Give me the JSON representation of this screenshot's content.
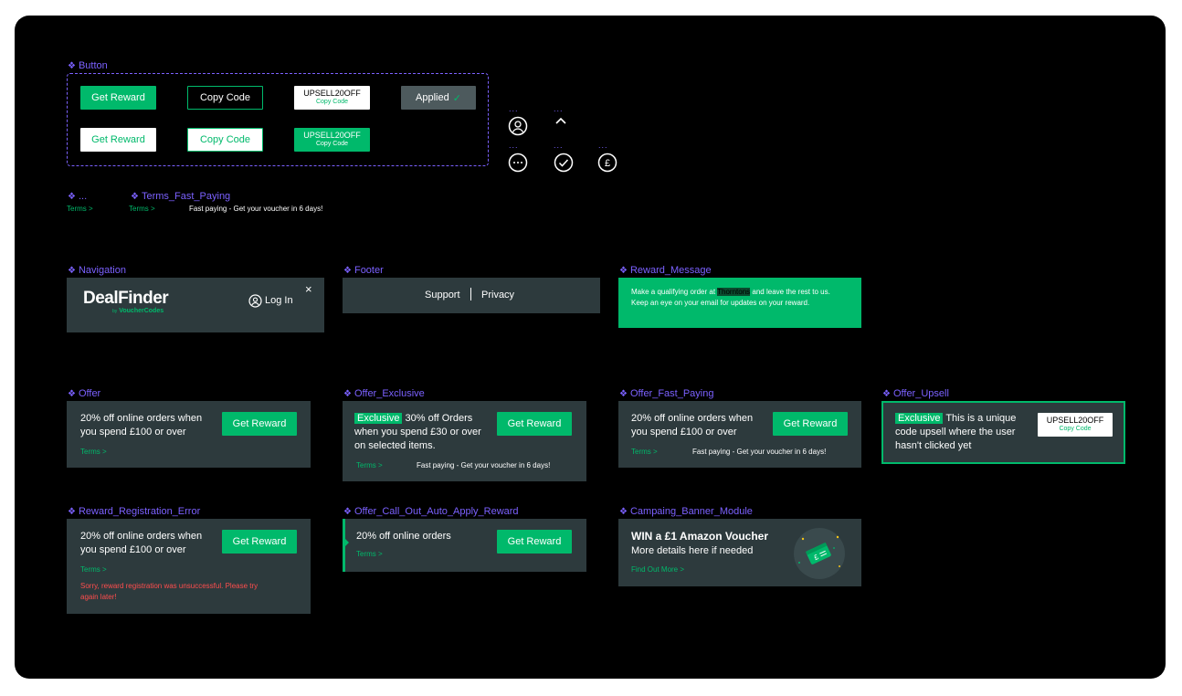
{
  "labels": {
    "button": "Button",
    "ellipsis": "...",
    "terms_fast": "Terms_Fast_Paying",
    "navigation": "Navigation",
    "footer": "Footer",
    "reward_message": "Reward_Message",
    "offer": "Offer",
    "offer_exclusive": "Offer_Exclusive",
    "offer_fast": "Offer_Fast_Paying",
    "offer_upsell": "Offer_Upsell",
    "reward_error": "Reward_Registration_Error",
    "offer_callout": "Offer_Call_Out_Auto_Apply_Reward",
    "campaign": "Campaing_Banner_Module"
  },
  "buttons": {
    "get_reward": "Get Reward",
    "copy_code": "Copy Code",
    "code": "UPSELL20OFF",
    "code_sub": "Copy Code",
    "applied": "Applied"
  },
  "icon_dots": "...",
  "terms": {
    "link": "Terms >",
    "fast_paying": "Fast paying - Get your voucher in 6 days!"
  },
  "navigation": {
    "logo": "DealFinder",
    "logo_sub_by": "by",
    "logo_sub": "VoucherCodes",
    "login": "Log In"
  },
  "footer": {
    "support": "Support",
    "privacy": "Privacy"
  },
  "reward_message": {
    "text_before": "Make a qualifying order at",
    "brand": "Thorntons",
    "text_after": "and leave the rest to us. Keep an eye on your email for updates on your reward."
  },
  "offer": {
    "text": "20% off online orders when you spend £100 or over"
  },
  "offer_exclusive": {
    "tag": "Exclusive",
    "text": "30% off Orders when you spend £30 or over on selected items."
  },
  "offer_upsell": {
    "tag": "Exclusive",
    "text": "This is a unique code upsell where the user hasn't clicked yet"
  },
  "reward_error": {
    "error": "Sorry, reward registration was unsuccessful. Please try again later!"
  },
  "offer_callout": {
    "text": "20% off online orders"
  },
  "campaign": {
    "title": "WIN a £1 Amazon Voucher",
    "subtitle": "More details here if needed",
    "link": "Find Out More >"
  },
  "colors": {
    "accent": "#00b96b",
    "label": "#7b61ff",
    "card": "#2d3a3d",
    "error": "#ff4d4d"
  }
}
